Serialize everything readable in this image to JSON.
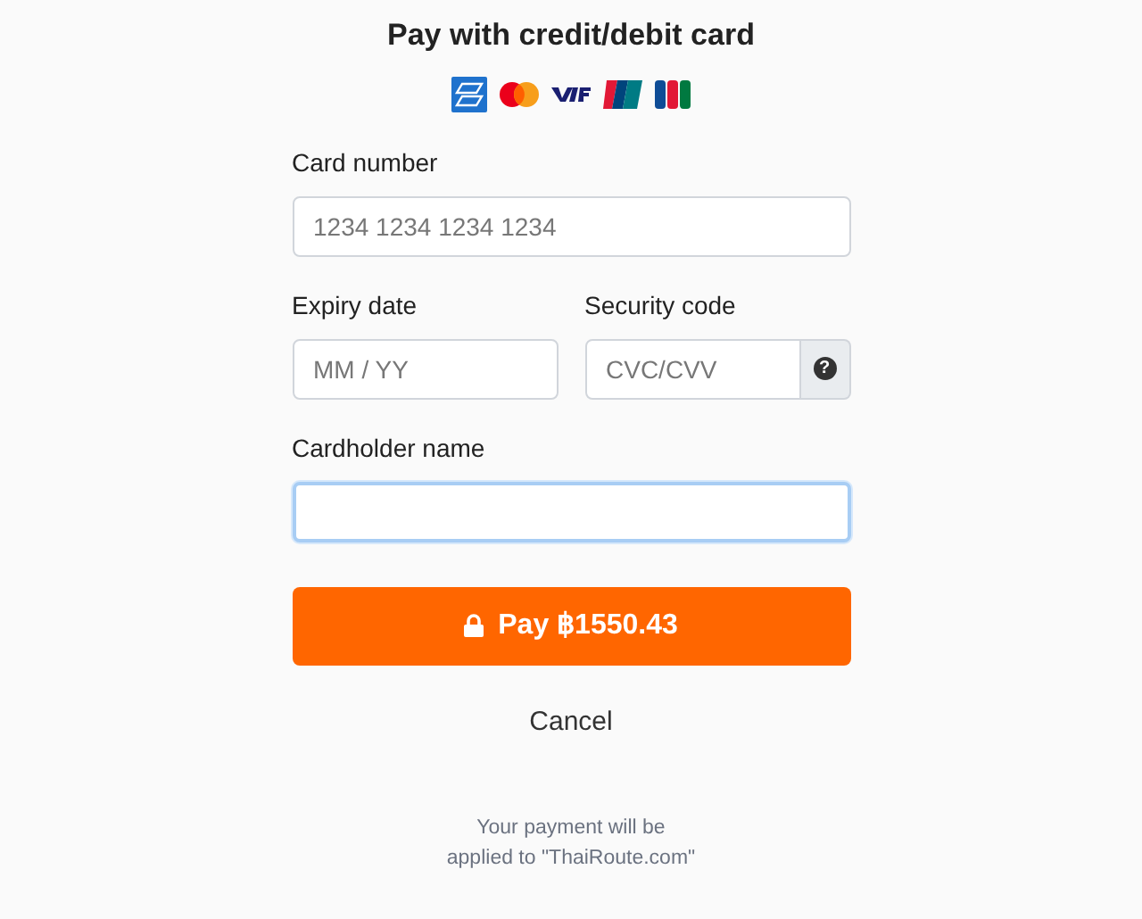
{
  "title": "Pay with credit/debit card",
  "card_brands": [
    {
      "kind": "amex"
    },
    {
      "kind": "mastercard"
    },
    {
      "kind": "visa"
    },
    {
      "kind": "unionpay"
    },
    {
      "kind": "jcb"
    }
  ],
  "fields": [
    {
      "label": "Card number",
      "placeholder": "1234 1234 1234 1234",
      "focused": false
    },
    {
      "label": "Expiry date",
      "placeholder": "MM / YY",
      "focused": false
    },
    {
      "label": "Security code",
      "placeholder": "CVC/CVV",
      "focused": false,
      "help": "?"
    },
    {
      "label": "Cardholder name",
      "focused": true
    }
  ],
  "pay_button": "Pay ฿1550.43",
  "cancel": "Cancel",
  "footer": "Your payment will be applied to \"ThaiRoute.com\""
}
